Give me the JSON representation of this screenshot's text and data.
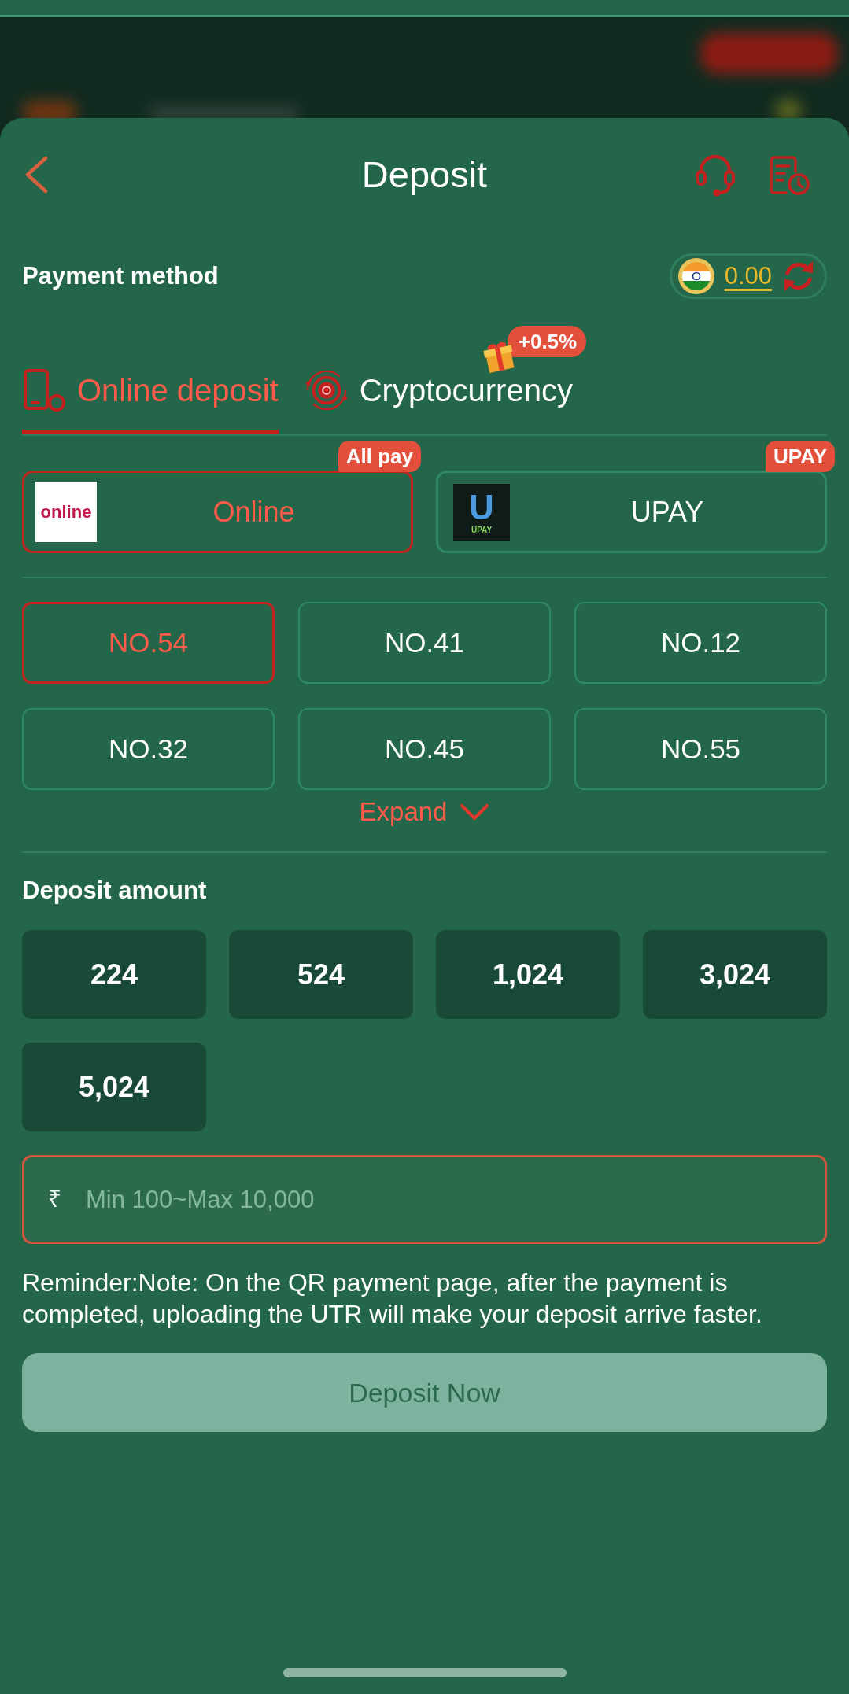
{
  "header": {
    "title": "Deposit"
  },
  "payment_method": {
    "label": "Payment method",
    "balance": "0.00"
  },
  "tabs": [
    {
      "label": "Online deposit",
      "kind": "online",
      "selected": true
    },
    {
      "label": "Cryptocurrency",
      "kind": "crypto",
      "selected": false,
      "badge": "+0.5%"
    }
  ],
  "providers": [
    {
      "name": "Online",
      "kind": "online",
      "logo_text": "online",
      "badge": "All pay",
      "selected": true
    },
    {
      "name": "UPAY",
      "kind": "upay",
      "logo_mark": "U",
      "logo_text": "UPAY",
      "badge": "UPAY",
      "selected": false
    }
  ],
  "channels": [
    {
      "label": "NO.54",
      "selected": true
    },
    {
      "label": "NO.41",
      "selected": false
    },
    {
      "label": "NO.12",
      "selected": false
    },
    {
      "label": "NO.32",
      "selected": false
    },
    {
      "label": "NO.45",
      "selected": false
    },
    {
      "label": "NO.55",
      "selected": false
    }
  ],
  "expand": {
    "label": "Expand"
  },
  "deposit_amount": {
    "label": "Deposit amount",
    "presets": [
      "224",
      "524",
      "1,024",
      "3,024",
      "5,024"
    ]
  },
  "amount_field": {
    "currency": "₹",
    "placeholder": "Min 100~Max 10,000"
  },
  "reminder": "Reminder:Note: On the QR payment page, after the payment is completed, uploading the UTR will make your deposit arrive faster.",
  "submit": {
    "label": "Deposit Now",
    "disabled": true
  }
}
